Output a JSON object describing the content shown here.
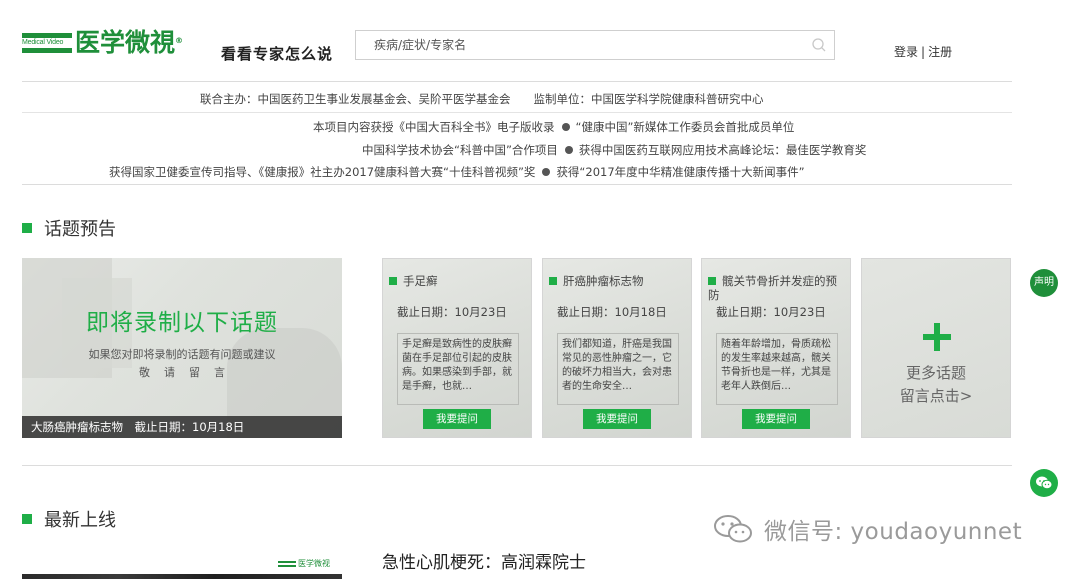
{
  "header": {
    "logo_badge": "Medical Video",
    "logo_text": "医学微視",
    "logo_reg": "®",
    "slogan": "看看专家怎么说",
    "search_placeholder": "疾病/症状/专家名",
    "login": "登录",
    "separator": "|",
    "register": "注册"
  },
  "sponsors": {
    "line1": "联合主办：中国医药卫生事业发展基金会、吴阶平医学基金会　　监制单位：中国医学科学院健康科普研究中心",
    "line2_left": "本项目内容获授《中国大百科全书》电子版收录",
    "line2_right": "“健康中国”新媒体工作委员会首批成员单位",
    "line3_left": "中国科学技术协会“科普中国”合作项目",
    "line3_right": "获得中国医药互联网应用技术高峰论坛：最佳医学教育奖",
    "line4_left": "获得国家卫健委宣传司指导、《健康报》社主办2017健康科普大赛“十佳科普视频”奖",
    "line4_right": "获得“2017年度中华精准健康传播十大新闻事件”"
  },
  "preview": {
    "section_title": "话题预告",
    "feature": {
      "title": "即将录制以下话题",
      "subtitle": "如果您对即将录制的话题有问题或建议",
      "subtitle2": "敬请留言",
      "caption": "大肠癌肿瘤标志物　截止日期：10月18日"
    },
    "topics": [
      {
        "name": "手足癣",
        "deadline": "截止日期：10月23日",
        "desc": "手足癣是致病性的皮肤癣菌在手足部位引起的皮肤病。如果感染到手部，就是手癣，也就…",
        "ask": "我要提问"
      },
      {
        "name": "肝癌肿瘤标志物",
        "deadline": "截止日期：10月18日",
        "desc": "我们都知道，肝癌是我国常见的恶性肿瘤之一，它的破坏力相当大，会对患者的生命安全…",
        "ask": "我要提问"
      },
      {
        "name": "髋关节骨折并发症的预防",
        "deadline": "截止日期：10月23日",
        "desc": "随着年龄增加，骨质疏松的发生率越来越高，髋关节骨折也是一样，尤其是老年人跌倒后…",
        "ask": "我要提问"
      }
    ],
    "more_line1": "更多话题",
    "more_line2": "留言点击>"
  },
  "side": {
    "statement": "声明"
  },
  "latest": {
    "section_title": "最新上线",
    "thumb_logo": "医学微视",
    "first_title": "急性心肌梗死：高润霖院士"
  },
  "watermark": {
    "text": "微信号: youdaoyunnet"
  },
  "colors": {
    "brand_green": "#1f8f3a",
    "accent_green": "#1fae47"
  }
}
